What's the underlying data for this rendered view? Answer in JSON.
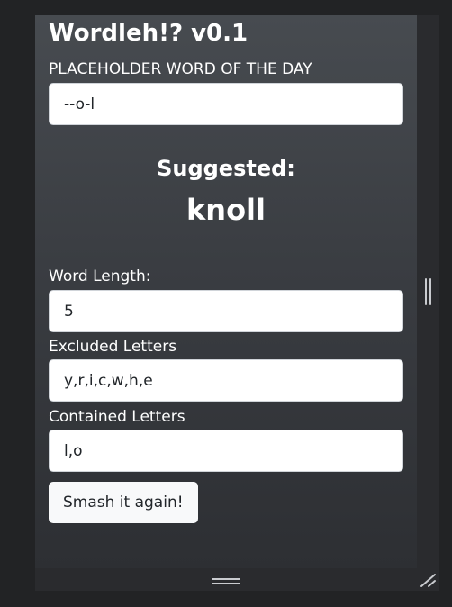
{
  "app": {
    "title": "Wordleh!? v0.1",
    "subtitle": "PLACEHOLDER WORD OF THE DAY"
  },
  "pattern": {
    "value": "--o-l"
  },
  "suggestion": {
    "label": "Suggested:",
    "word": "knoll"
  },
  "form": {
    "word_length": {
      "label": "Word Length:",
      "value": "5"
    },
    "excluded": {
      "label": "Excluded Letters",
      "value": "y,r,i,c,w,h,e"
    },
    "contained": {
      "label": "Contained Letters",
      "value": "l,o"
    },
    "submit_label": "Smash it again!"
  },
  "icons": {
    "right_handle": "vertical-resize-grip-icon",
    "bottom_handle": "horizontal-resize-grip-icon",
    "corner_handle": "corner-resize-grip-icon"
  },
  "colors": {
    "page_background": "#222325",
    "panel_top": "#474b50",
    "panel_bottom": "#2d2f33",
    "text": "#ffffff",
    "button_background": "#f8f9fa"
  }
}
